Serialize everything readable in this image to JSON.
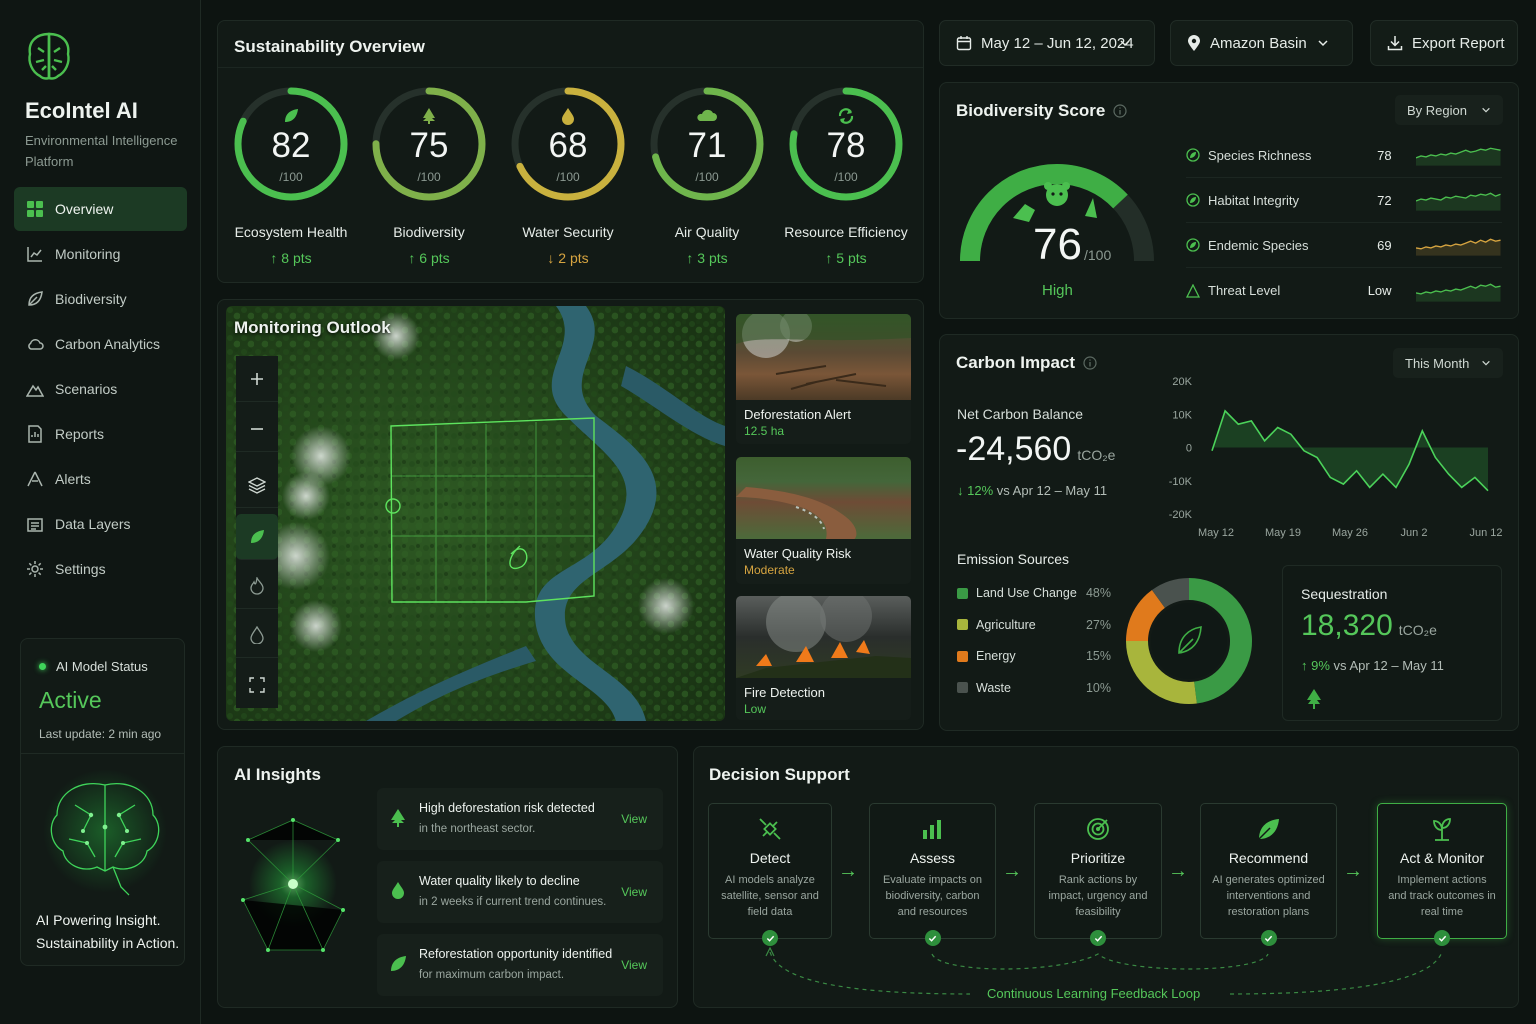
{
  "brand": {
    "name": "EcoIntel AI",
    "subtitle": "Environmental Intelligence Platform"
  },
  "nav": [
    {
      "label": "Overview",
      "icon": "grid-icon",
      "active": true
    },
    {
      "label": "Monitoring",
      "icon": "chart-icon"
    },
    {
      "label": "Biodiversity",
      "icon": "leaf-icon"
    },
    {
      "label": "Carbon Analytics",
      "icon": "cloud-icon"
    },
    {
      "label": "Scenarios",
      "icon": "mountain-icon"
    },
    {
      "label": "Reports",
      "icon": "report-icon"
    },
    {
      "label": "Alerts",
      "icon": "alert-icon"
    },
    {
      "label": "Data Layers",
      "icon": "layers-icon"
    },
    {
      "label": "Settings",
      "icon": "gear-icon"
    }
  ],
  "model_status": {
    "title": "AI Model Status",
    "value": "Active",
    "updated": "Last update: 2 min ago",
    "tagline_1": "AI Powering Insight.",
    "tagline_2": "Sustainability in Action."
  },
  "overview": {
    "title": "Sustainability Overview",
    "metrics": [
      {
        "value": "82",
        "denom": "/100",
        "label": "Ecosystem Health",
        "delta": "↑ 8 pts",
        "trend": "up",
        "fraction": 0.82,
        "color": "#4bbf4f",
        "icon": "leaf-icon"
      },
      {
        "value": "75",
        "denom": "/100",
        "label": "Biodiversity",
        "delta": "↑ 6 pts",
        "trend": "up",
        "fraction": 0.75,
        "color": "#7fb04a",
        "icon": "tree-icon"
      },
      {
        "value": "68",
        "denom": "/100",
        "label": "Water Security",
        "delta": "↓ 2 pts",
        "trend": "down",
        "fraction": 0.68,
        "color": "#c9b13e",
        "icon": "drop-icon"
      },
      {
        "value": "71",
        "denom": "/100",
        "label": "Air Quality",
        "delta": "↑ 3 pts",
        "trend": "up",
        "fraction": 0.71,
        "color": "#6fb54c",
        "icon": "cloud-icon"
      },
      {
        "value": "78",
        "denom": "/100",
        "label": "Resource Efficiency",
        "delta": "↑ 5 pts",
        "trend": "up",
        "fraction": 0.78,
        "color": "#4bbf4f",
        "icon": "recycle-icon"
      }
    ]
  },
  "top": {
    "date_range": "May 12 – Jun 12, 2024",
    "region": "Amazon Basin",
    "export": "Export Report"
  },
  "biodiversity": {
    "title": "Biodiversity Score",
    "filter": "By Region",
    "score": "76",
    "denom": "/100",
    "level": "High",
    "fraction": 0.76,
    "rows": [
      {
        "name": "Species Richness",
        "value": "78",
        "color": "#4bbf4f"
      },
      {
        "name": "Habitat Integrity",
        "value": "72",
        "color": "#4bbf4f"
      },
      {
        "name": "Endemic Species",
        "value": "69",
        "color": "#d6a440"
      },
      {
        "name": "Threat Level",
        "value": "Low",
        "color": "#4bbf4f"
      }
    ]
  },
  "monitoring": {
    "title": "Monitoring Outlook",
    "alerts": [
      {
        "title": "Deforestation Alert",
        "detail": "12.5 ha",
        "tone": "green"
      },
      {
        "title": "Water Quality Risk",
        "detail": "Moderate",
        "tone": "amber"
      },
      {
        "title": "Fire Detection",
        "detail": "Low",
        "tone": "green"
      }
    ]
  },
  "carbon": {
    "title": "Carbon Impact",
    "filter": "This Month",
    "net_label": "Net Carbon Balance",
    "net_value": "-24,560",
    "net_unit": "tCO₂e",
    "net_delta": "12%",
    "net_delta_text": "vs Apr 12 – May 11",
    "emission_title": "Emission Sources",
    "sources": [
      {
        "name": "Land Use Change",
        "pct": "48%",
        "value": 48,
        "color": "#3a9a45"
      },
      {
        "name": "Agriculture",
        "pct": "27%",
        "value": 27,
        "color": "#a8b53c"
      },
      {
        "name": "Energy",
        "pct": "15%",
        "value": 15,
        "color": "#e07a1c"
      },
      {
        "name": "Waste",
        "pct": "10%",
        "value": 10,
        "color": "#4a524e"
      }
    ],
    "seq_title": "Sequestration",
    "seq_value": "18,320",
    "seq_unit": "tCO₂e",
    "seq_delta": "9%",
    "seq_delta_text": "vs Apr 12 – May 11"
  },
  "chart_data": {
    "type": "area",
    "x_ticks": [
      "May 12",
      "May 19",
      "May 26",
      "Jun 2",
      "Jun 12"
    ],
    "y_ticks": [
      "20K",
      "10K",
      "0",
      "-10K",
      "-20K"
    ],
    "ylim": [
      -20000,
      20000
    ],
    "series": [
      {
        "values": [
          -1000,
          11000,
          7000,
          8000,
          2000,
          6000,
          4000,
          -1000,
          -3000,
          -9000,
          -11000,
          -7000,
          -12000,
          -8000,
          -12000,
          -5000,
          5000,
          -3000,
          -8000,
          -12000,
          -9000,
          -13000
        ]
      }
    ]
  },
  "insights": {
    "title": "AI Insights",
    "items": [
      {
        "title": "High deforestation risk detected",
        "sub": "in the northeast sector.",
        "action": "View",
        "icon": "tree-icon"
      },
      {
        "title": "Water quality likely to decline",
        "sub": "in 2 weeks if current trend continues.",
        "action": "View",
        "icon": "drop-icon"
      },
      {
        "title": "Reforestation opportunity identified",
        "sub": "for maximum carbon impact.",
        "action": "View",
        "icon": "leaf-icon"
      }
    ]
  },
  "decision": {
    "title": "Decision Support",
    "steps": [
      {
        "name": "Detect",
        "desc": "AI models analyze satellite, sensor and field data",
        "icon": "satellite-icon"
      },
      {
        "name": "Assess",
        "desc": "Evaluate impacts on biodiversity, carbon and resources",
        "icon": "bars-icon"
      },
      {
        "name": "Prioritize",
        "desc": "Rank actions by impact, urgency and feasibility",
        "icon": "target-icon"
      },
      {
        "name": "Recommend",
        "desc": "AI generates optimized interventions and restoration plans",
        "icon": "leaf-icon"
      },
      {
        "name": "Act & Monitor",
        "desc": "Implement actions and track outcomes in real time",
        "icon": "sprout-icon"
      }
    ],
    "loop": "Continuous Learning Feedback Loop"
  },
  "colors": {
    "accent": "#55c75a",
    "amber": "#d6a440",
    "bg": "#0d1411",
    "panel": "#121a16"
  }
}
